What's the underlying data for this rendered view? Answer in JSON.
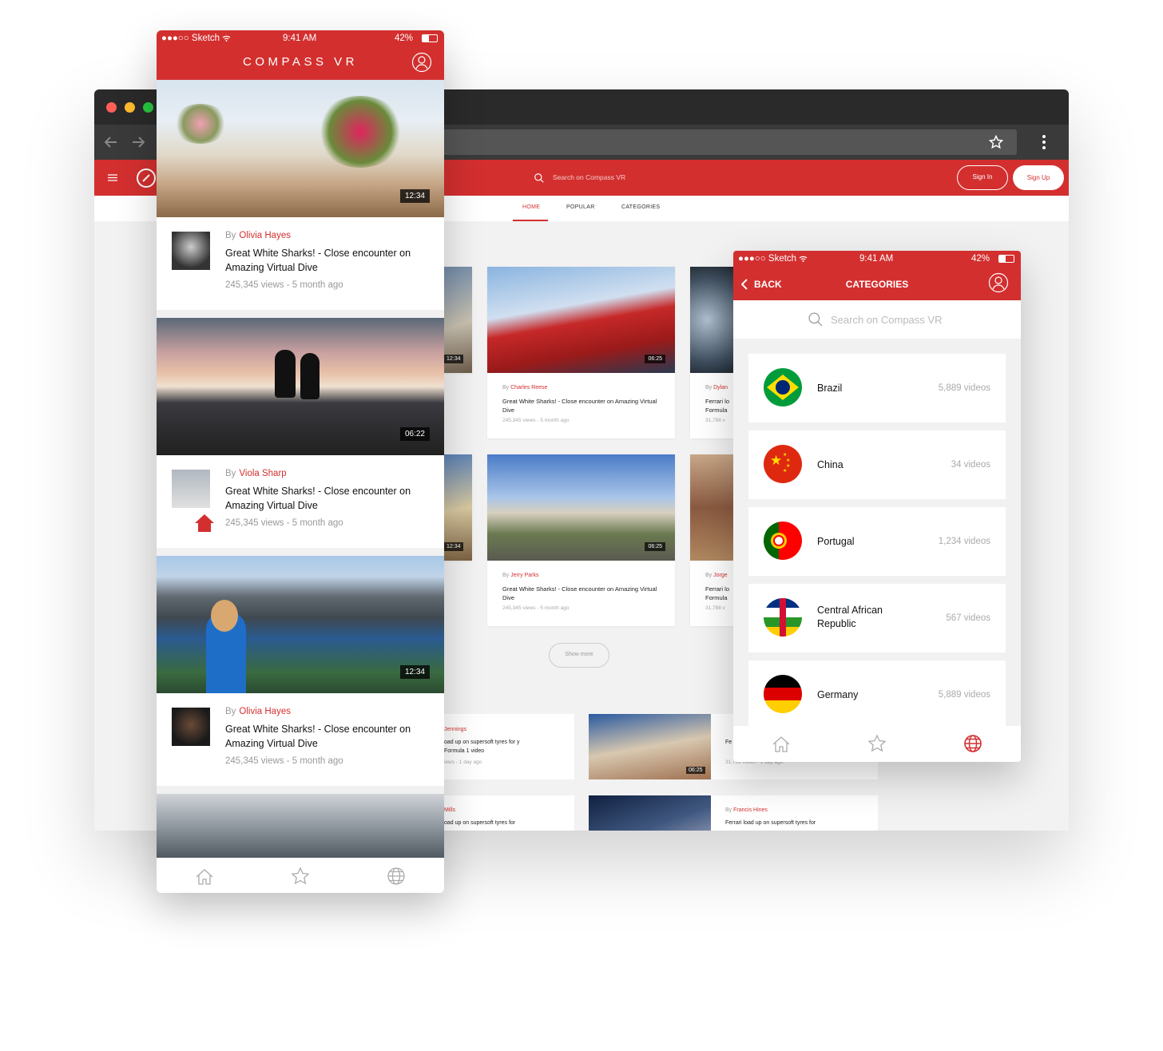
{
  "app_name": "COMPASS VR",
  "web": {
    "search_placeholder": "Search on Compass VR",
    "sign_in": "Sign In",
    "sign_up": "Sign Up",
    "tabs": [
      "HOME",
      "POPULAR",
      "CATEGORIES"
    ],
    "active_tab": "HOME",
    "by": "By",
    "cards": [
      {
        "author": "Charles Reese",
        "title": "Great White Sharks! - Close encounter on Amazing Virtual Dive",
        "meta": "245,345 views - 5 month ago",
        "duration": "06:25"
      },
      {
        "author": "Jerry Parks",
        "title": "Great White Sharks! - Close encounter on Amazing Virtual Dive",
        "meta": "245,345 views - 5 month ago",
        "duration": "06:25"
      },
      {
        "author": "Dylan",
        "title": "Ferrari lo Formula",
        "meta": "31,788 v"
      },
      {
        "author": "Jorge",
        "title": "Ferrari lo Formula",
        "meta": "31,788 v"
      }
    ],
    "left_durations": [
      "12:34",
      "12:34"
    ],
    "show_more": "Show more",
    "wide_cards": [
      {
        "author": "Jennings",
        "title": "oad up on supersoft tyres for y Formula 1 video",
        "meta": "iews - 1 day ago"
      },
      {
        "author": "",
        "title": "Fe Fo",
        "meta": "31,788 views - 1 day ago",
        "duration": "06:25"
      },
      {
        "author": "Mills",
        "title": "oad up on supersoft tyres for",
        "meta": ""
      },
      {
        "author": "Francis Hines",
        "title": "Ferrari load up on supersoft tyres for",
        "meta": ""
      }
    ]
  },
  "status": {
    "carrier": "●●●○○ Sketch",
    "time": "9:41 AM",
    "battery": "42%"
  },
  "phone_left": {
    "by": "By",
    "items": [
      {
        "duration": "12:34",
        "author": "Olivia Hayes",
        "title": "Great White Sharks! - Close encounter on Amazing Virtual Dive",
        "meta": "245,345 views - 5 month ago"
      },
      {
        "duration": "06:22",
        "author": "Viola Sharp",
        "title": "Great White Sharks! - Close encounter on Amazing Virtual Dive",
        "meta": "245,345 views - 5 month ago"
      },
      {
        "duration": "12:34",
        "author": "Olivia Hayes",
        "title": "Great White Sharks! - Close encounter on Amazing Virtual Dive",
        "meta": "245,345 views - 5 month ago"
      }
    ]
  },
  "phone_right": {
    "back": "BACK",
    "title": "CATEGORIES",
    "search_placeholder": "Search on Compass VR",
    "categories": [
      {
        "name": "Brazil",
        "count": "5,889 videos"
      },
      {
        "name": "China",
        "count": "34 videos"
      },
      {
        "name": "Portugal",
        "count": "1,234 videos"
      },
      {
        "name": "Central African Republic",
        "count": "567 videos"
      },
      {
        "name": "Germany",
        "count": "5,889 videos"
      }
    ]
  },
  "colors": {
    "brand_red": "#d32f2f"
  },
  "icons": [
    "back-arrow-icon",
    "forward-arrow-icon",
    "star-icon",
    "more-vert-icon",
    "hamburger-icon",
    "compass-logo-icon",
    "search-icon",
    "user-icon",
    "home-icon",
    "globe-icon",
    "chevron-left-icon"
  ]
}
